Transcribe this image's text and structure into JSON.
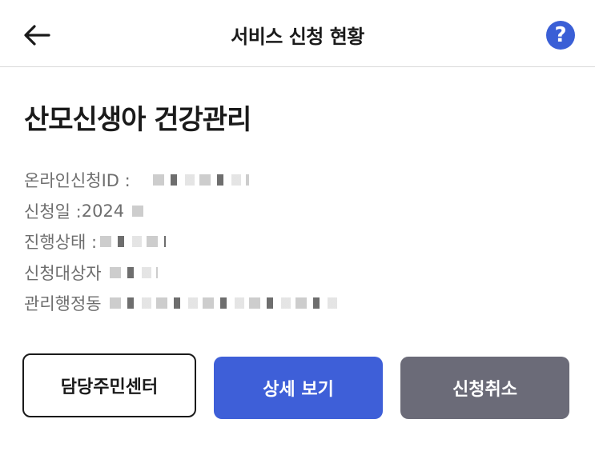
{
  "header": {
    "title": "서비스 신청 현황",
    "back_icon": "arrow-left-icon",
    "help_label": "?",
    "help_icon": "question-circle-icon",
    "help_color": "#3a5fd6"
  },
  "service": {
    "title": "산모신생아 건강관리"
  },
  "info": {
    "application_id_label": "온라인신청ID :",
    "application_date_label": "신청일 :",
    "application_date_value": "2024",
    "status_label": "진행상태 :",
    "applicant_label": "신청대상자",
    "admin_dong_label": "관리행정동"
  },
  "buttons": {
    "manager_label": "담당주민센터",
    "detail_label": "상세 보기",
    "cancel_label": "신청취소",
    "primary_color": "#3e5fd8",
    "gray_color": "#6b6b78"
  }
}
